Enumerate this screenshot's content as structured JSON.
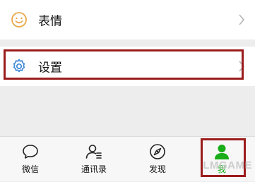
{
  "menu": {
    "emoji_label": "表情",
    "settings_label": "设置"
  },
  "tabs": [
    {
      "label": "微信",
      "icon": "chat-bubble-icon"
    },
    {
      "label": "通讯录",
      "icon": "contacts-icon"
    },
    {
      "label": "发现",
      "icon": "compass-icon"
    },
    {
      "label": "我",
      "icon": "person-icon",
      "active": true
    }
  ],
  "watermark": "LMGAME",
  "colors": {
    "accent_green": "#1aad19",
    "highlight_red": "#9b1c1c",
    "emoji_icon_orange": "#e9a94b",
    "settings_icon_blue": "#3f8ad6"
  }
}
